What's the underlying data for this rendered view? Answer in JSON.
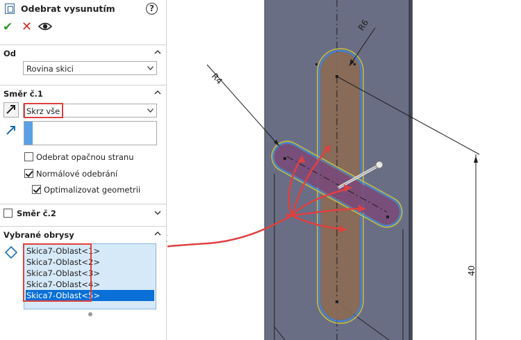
{
  "title": "Odebrat vysunutím",
  "help_label": "?",
  "section_od": {
    "title": "Od",
    "value": "Rovina skici"
  },
  "section_dir1": {
    "title": "Směr č.1",
    "end_condition": "Skrz vše",
    "reverse_side_label": "Odebrat opačnou stranu",
    "normal_cut_label": "Normálové odebrání",
    "optimize_label": "Optimalizovat geometrii",
    "reverse_side_checked": false,
    "normal_cut_checked": true,
    "optimize_checked": true
  },
  "section_dir2": {
    "title": "Směr č.2",
    "checked": false
  },
  "section_contours": {
    "title": "Vybrané obrysy",
    "items": [
      "Skica7-Oblast<1>",
      "Skica7-Oblast<2>",
      "Skica7-Oblast<3>",
      "Skica7-Oblast<4>",
      "Skica7-Oblast<5>"
    ],
    "selected_index": 4
  },
  "viewport": {
    "dim_r4": "R4",
    "dim_r6": "R6",
    "dim_40": "40"
  },
  "colors": {
    "highlight_red": "#e04040",
    "selection_blue": "#0a6fd6",
    "list_bg": "#d6e9f8",
    "part_face": "#6a6e85",
    "slot_brown": "#8a6a55",
    "slot_purple": "#7a4a7a"
  }
}
